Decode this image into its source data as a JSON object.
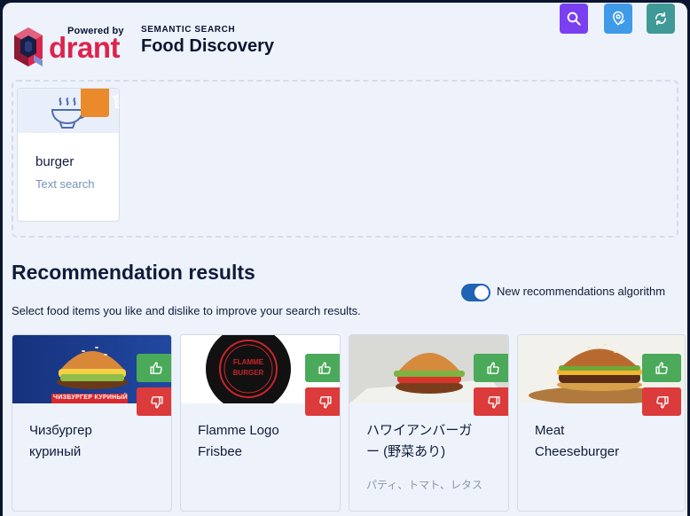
{
  "header": {
    "powered_by": "Powered by",
    "logo_word": "drant",
    "subtitle": "SEMANTIC SEARCH",
    "title": "Food Discovery"
  },
  "toolbar": {
    "buttons": [
      {
        "name": "search",
        "icon": "search-icon",
        "color": "#7a3ff0"
      },
      {
        "name": "location",
        "icon": "location-icon",
        "color": "#3f9be8"
      },
      {
        "name": "reset",
        "icon": "refresh-icon",
        "color": "#3f9997"
      }
    ]
  },
  "query": {
    "items": [
      {
        "label": "burger",
        "type": "Text search",
        "icon": "bowl-icon",
        "delete_icon": "trash-icon"
      }
    ]
  },
  "results": {
    "heading": "Recommendation results",
    "toggle_label": "New recommendations algorithm",
    "toggle_on": true,
    "hint": "Select food items you like and dislike to improve your search results.",
    "cards": [
      {
        "name": "Чизбургер куриный",
        "description": "",
        "image": "chicken-cheeseburger-photo",
        "banner_text": "ЧИЗБУРГЕР КУРИНЫЙ"
      },
      {
        "name": "Flamme Logo Frisbee",
        "description": "",
        "image": "flamme-logo-frisbee-photo",
        "logo_text": "FLAMME BURGER"
      },
      {
        "name": "ハワイアンバーガー (野菜あり)",
        "description": "パティ、トマト、レタス",
        "image": "hawaiian-burger-photo"
      },
      {
        "name": "Meat Cheeseburger",
        "description": "",
        "image": "meat-cheeseburger-photo"
      }
    ]
  },
  "colors": {
    "like": "#4aaa5a",
    "dislike": "#dc3b3b",
    "delete": "#ea8a2a",
    "brand_red": "#dc244c",
    "toggle": "#1e63b5"
  }
}
